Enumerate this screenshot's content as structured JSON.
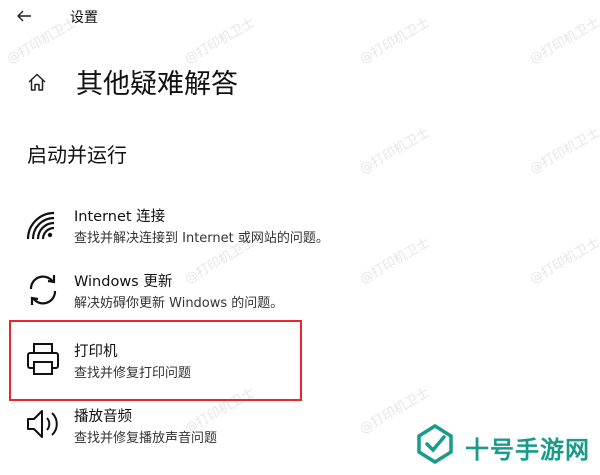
{
  "header": {
    "app_title": "设置",
    "back_icon": "back-arrow-icon"
  },
  "page": {
    "title": "其他疑难解答",
    "home_icon": "home-icon"
  },
  "section": {
    "title": "启动并运行"
  },
  "items": [
    {
      "label": "Internet 连接",
      "description": "查找并解决连接到 Internet 或网站的问题。",
      "icon": "wifi-icon"
    },
    {
      "label": "Windows 更新",
      "description": "解决妨碍你更新 Windows 的问题。",
      "icon": "refresh-icon"
    },
    {
      "label": "打印机",
      "description": "查找并修复打印问题",
      "icon": "printer-icon"
    },
    {
      "label": "播放音频",
      "description": "查找并修复播放声音问题",
      "icon": "speaker-icon"
    }
  ],
  "highlight": {
    "color": "#e8262c",
    "target": "打印机"
  },
  "watermark": {
    "text": "@打印机卫士"
  },
  "brand": {
    "name": "十号手游网",
    "color": "#1a9b8a"
  }
}
